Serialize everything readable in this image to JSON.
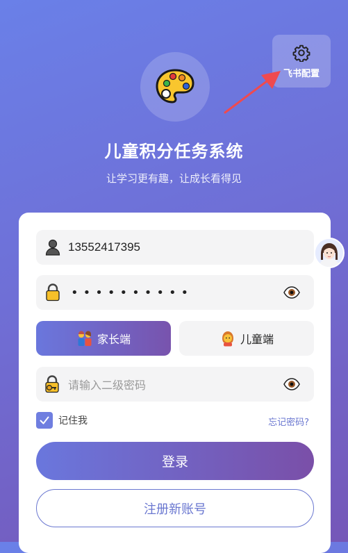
{
  "header": {
    "settings_label": "飞书配置",
    "title": "儿童积分任务系统",
    "subtitle": "让学习更有趣，让成长看得见"
  },
  "form": {
    "phone_value": "13552417395",
    "password_mask": "••••••••••",
    "role_parent_label": "家长端",
    "role_child_label": "儿童端",
    "second_password_placeholder": "请输入二级密码",
    "remember_label": "记住我",
    "remember_checked": true,
    "forgot_label": "忘记密码?",
    "login_label": "登录",
    "register_label": "注册新账号"
  },
  "icons": {
    "settings": "gear-icon",
    "logo": "palette-icon",
    "phone": "user-silhouette-icon",
    "password": "lock-icon",
    "second_password": "lock-with-key-icon",
    "toggle_visibility": "eye-icon",
    "parent": "family-icon",
    "child": "child-icon",
    "assistant": "assistant-avatar-icon"
  },
  "colors": {
    "accent": "#6a77dd",
    "accent_end": "#7853ad",
    "arrow": "#ef4a4f"
  }
}
